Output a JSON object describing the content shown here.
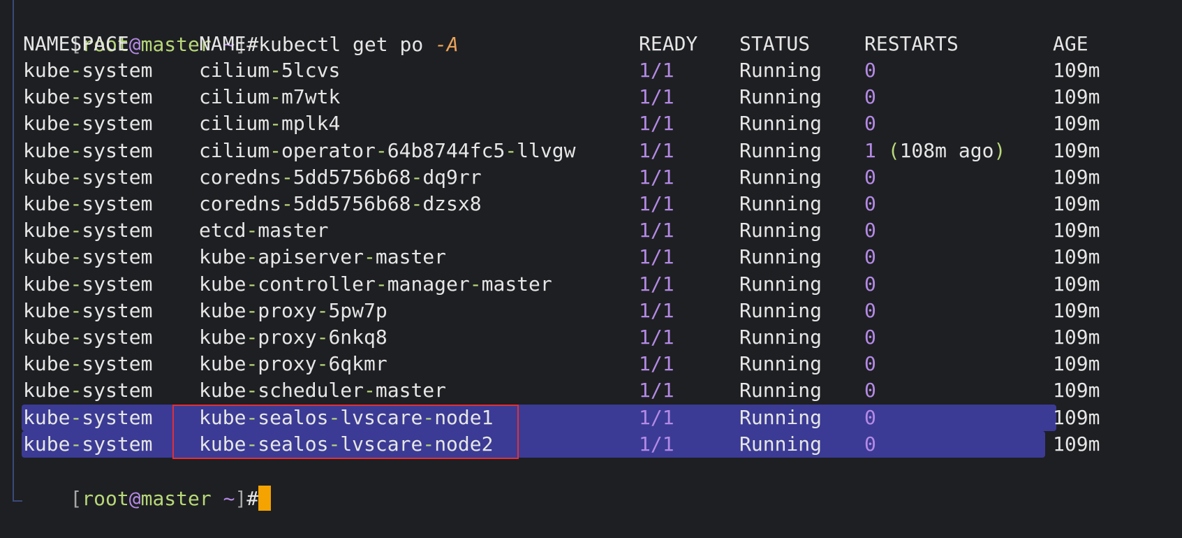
{
  "prompt": {
    "user": "root",
    "at": "@",
    "host": "master",
    "path": "~",
    "open_bracket": "[",
    "close_bracket": "]",
    "hash": "#"
  },
  "command": {
    "text": "kubectl get po ",
    "flag": "-A"
  },
  "headers": [
    "NAMESPACE",
    "NAME",
    "READY",
    "STATUS",
    "RESTARTS",
    "AGE"
  ],
  "pods": [
    {
      "namespace": "kube-system",
      "name": "cilium-5lcvs",
      "ready": "1/1",
      "status": "Running",
      "restarts": "0",
      "restarts_extra": "",
      "age": "109m"
    },
    {
      "namespace": "kube-system",
      "name": "cilium-m7wtk",
      "ready": "1/1",
      "status": "Running",
      "restarts": "0",
      "restarts_extra": "",
      "age": "109m"
    },
    {
      "namespace": "kube-system",
      "name": "cilium-mplk4",
      "ready": "1/1",
      "status": "Running",
      "restarts": "0",
      "restarts_extra": "",
      "age": "109m"
    },
    {
      "namespace": "kube-system",
      "name": "cilium-operator-64b8744fc5-llvgw",
      "ready": "1/1",
      "status": "Running",
      "restarts": "1",
      "restarts_extra": "108m ago",
      "age": "109m"
    },
    {
      "namespace": "kube-system",
      "name": "coredns-5dd5756b68-dq9rr",
      "ready": "1/1",
      "status": "Running",
      "restarts": "0",
      "restarts_extra": "",
      "age": "109m"
    },
    {
      "namespace": "kube-system",
      "name": "coredns-5dd5756b68-dzsx8",
      "ready": "1/1",
      "status": "Running",
      "restarts": "0",
      "restarts_extra": "",
      "age": "109m"
    },
    {
      "namespace": "kube-system",
      "name": "etcd-master",
      "ready": "1/1",
      "status": "Running",
      "restarts": "0",
      "restarts_extra": "",
      "age": "109m"
    },
    {
      "namespace": "kube-system",
      "name": "kube-apiserver-master",
      "ready": "1/1",
      "status": "Running",
      "restarts": "0",
      "restarts_extra": "",
      "age": "109m"
    },
    {
      "namespace": "kube-system",
      "name": "kube-controller-manager-master",
      "ready": "1/1",
      "status": "Running",
      "restarts": "0",
      "restarts_extra": "",
      "age": "109m"
    },
    {
      "namespace": "kube-system",
      "name": "kube-proxy-5pw7p",
      "ready": "1/1",
      "status": "Running",
      "restarts": "0",
      "restarts_extra": "",
      "age": "109m"
    },
    {
      "namespace": "kube-system",
      "name": "kube-proxy-6nkq8",
      "ready": "1/1",
      "status": "Running",
      "restarts": "0",
      "restarts_extra": "",
      "age": "109m"
    },
    {
      "namespace": "kube-system",
      "name": "kube-proxy-6qkmr",
      "ready": "1/1",
      "status": "Running",
      "restarts": "0",
      "restarts_extra": "",
      "age": "109m"
    },
    {
      "namespace": "kube-system",
      "name": "kube-scheduler-master",
      "ready": "1/1",
      "status": "Running",
      "restarts": "0",
      "restarts_extra": "",
      "age": "109m"
    },
    {
      "namespace": "kube-system",
      "name": "kube-sealos-lvscare-node1",
      "ready": "1/1",
      "status": "Running",
      "restarts": "0",
      "restarts_extra": "",
      "age": "109m",
      "selected": true,
      "highlighted": true
    },
    {
      "namespace": "kube-system",
      "name": "kube-sealos-lvscare-node2",
      "ready": "1/1",
      "status": "Running",
      "restarts": "0",
      "restarts_extra": "",
      "age": "109m",
      "selected": true,
      "highlighted": true
    }
  ],
  "colors": {
    "background": "#1e1f22",
    "text": "#e6e6e6",
    "dash": "#b8d87a",
    "number": "#b48ae6",
    "flag": "#e8a35a",
    "selection": "#3b3b95",
    "highlight_box": "#e0303a",
    "cursor": "#f5a300"
  }
}
